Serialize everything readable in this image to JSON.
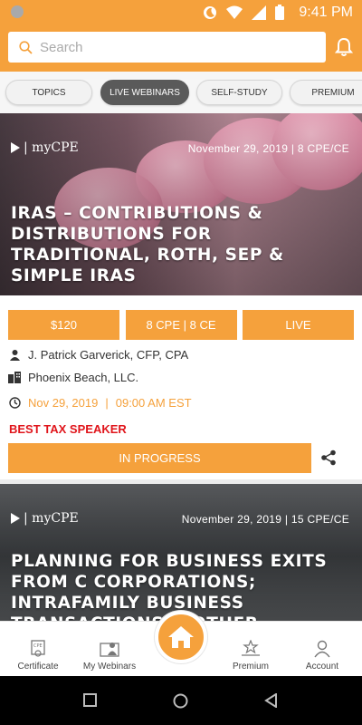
{
  "status_bar": {
    "time": "9:41 PM"
  },
  "search": {
    "placeholder": "Search"
  },
  "tabs": [
    {
      "label": "TOPICS",
      "active": false
    },
    {
      "label": "LIVE WEBINARS",
      "active": true
    },
    {
      "label": "SELF-STUDY",
      "active": false
    },
    {
      "label": "PREMIUM",
      "active": false
    }
  ],
  "webinars": [
    {
      "brand": "| myCPE",
      "banner_date": "November 29, 2019 | 8 CPE/CE",
      "title": "IRAS – CONTRIBUTIONS & DISTRIBUTIONS FOR TRADITIONAL, ROTH, SEP & SIMPLE IRAS",
      "price": "$120",
      "credits": "8 CPE | 8 CE",
      "status": "LIVE",
      "speaker": "J. Patrick Garverick, CFP, CPA",
      "company": "Phoenix Beach, LLC.",
      "date": "Nov 29, 2019",
      "time": "09:00 AM EST",
      "award": "BEST TAX SPEAKER",
      "progress_label": "IN PROGRESS"
    },
    {
      "brand": "| myCPE",
      "banner_date": "November 29, 2019 | 15 CPE/CE",
      "title": "PLANNING FOR BUSINESS EXITS FROM C CORPORATIONS; INTRAFAMILY BUSINESS TRANSACTIONS & OTHER"
    }
  ],
  "bottom_nav": [
    {
      "label": "Certificate",
      "icon": "certificate-icon"
    },
    {
      "label": "My Webinars",
      "icon": "my-webinars-icon"
    },
    {
      "label": "",
      "icon": "home-icon"
    },
    {
      "label": "Premium",
      "icon": "premium-icon"
    },
    {
      "label": "Account",
      "icon": "account-icon"
    }
  ],
  "colors": {
    "accent": "#f5a13c",
    "award": "#e0151b",
    "active_tab": "#5a5a5a"
  }
}
